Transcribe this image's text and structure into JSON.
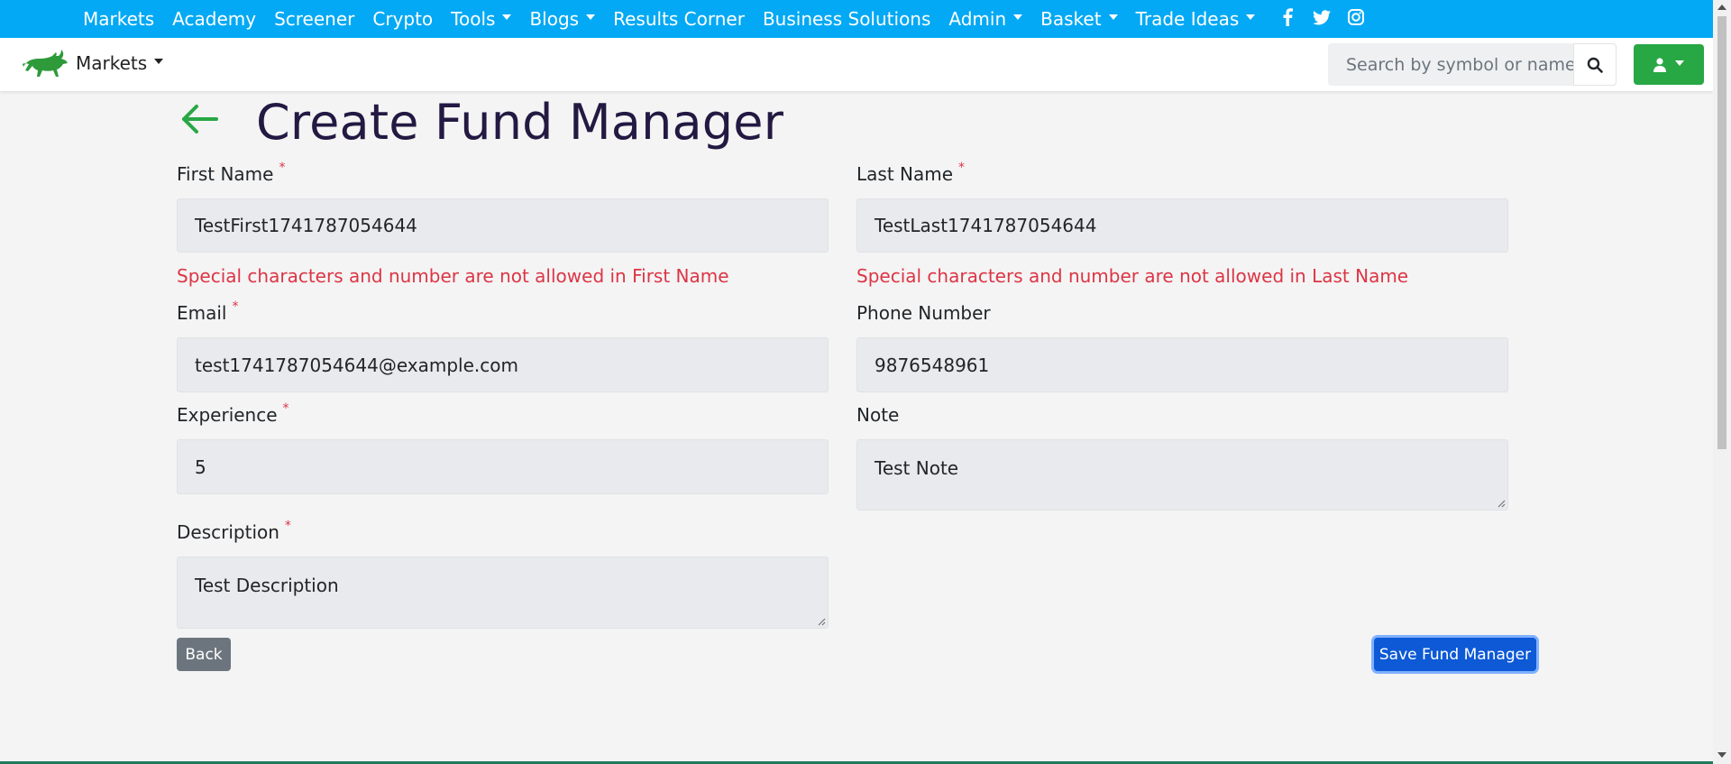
{
  "topnav": {
    "items": [
      {
        "label": "Markets",
        "dropdown": false
      },
      {
        "label": "Academy",
        "dropdown": false
      },
      {
        "label": "Screener",
        "dropdown": false
      },
      {
        "label": "Crypto",
        "dropdown": false
      },
      {
        "label": "Tools",
        "dropdown": true
      },
      {
        "label": "Blogs",
        "dropdown": true
      },
      {
        "label": "Results Corner",
        "dropdown": false
      },
      {
        "label": "Business Solutions",
        "dropdown": false
      },
      {
        "label": "Admin",
        "dropdown": true
      },
      {
        "label": "Basket",
        "dropdown": true
      },
      {
        "label": "Trade Ideas",
        "dropdown": true
      }
    ],
    "social_icons": [
      "facebook-icon",
      "twitter-icon",
      "instagram-icon"
    ],
    "background": "#03a9f4"
  },
  "subbar": {
    "brand_label": "Markets",
    "search_placeholder": "Search by symbol or name",
    "user_button_color": "#28a745"
  },
  "page": {
    "title": "Create Fund Manager",
    "fields": {
      "first_name": {
        "label": "First Name",
        "required": "*",
        "value": "TestFirst1741787054644",
        "error": "Special characters and number are not allowed in First Name"
      },
      "last_name": {
        "label": "Last Name",
        "required": "*",
        "value": "TestLast1741787054644",
        "error": "Special characters and number are not allowed in Last Name"
      },
      "email": {
        "label": "Email",
        "required": "*",
        "value": "test1741787054644@example.com"
      },
      "phone": {
        "label": "Phone Number",
        "value": "9876548961"
      },
      "experience": {
        "label": "Experience",
        "required": "*",
        "value": "5"
      },
      "note": {
        "label": "Note",
        "value": "Test Note"
      },
      "description": {
        "label": "Description",
        "required": "*",
        "value": "Test Description"
      }
    },
    "buttons": {
      "back": "Back",
      "save": "Save Fund Manager"
    }
  },
  "colors": {
    "accent_green": "#28a745",
    "error_red": "#dc3545",
    "primary_blue": "#0d59d6",
    "title_color": "#231942"
  }
}
